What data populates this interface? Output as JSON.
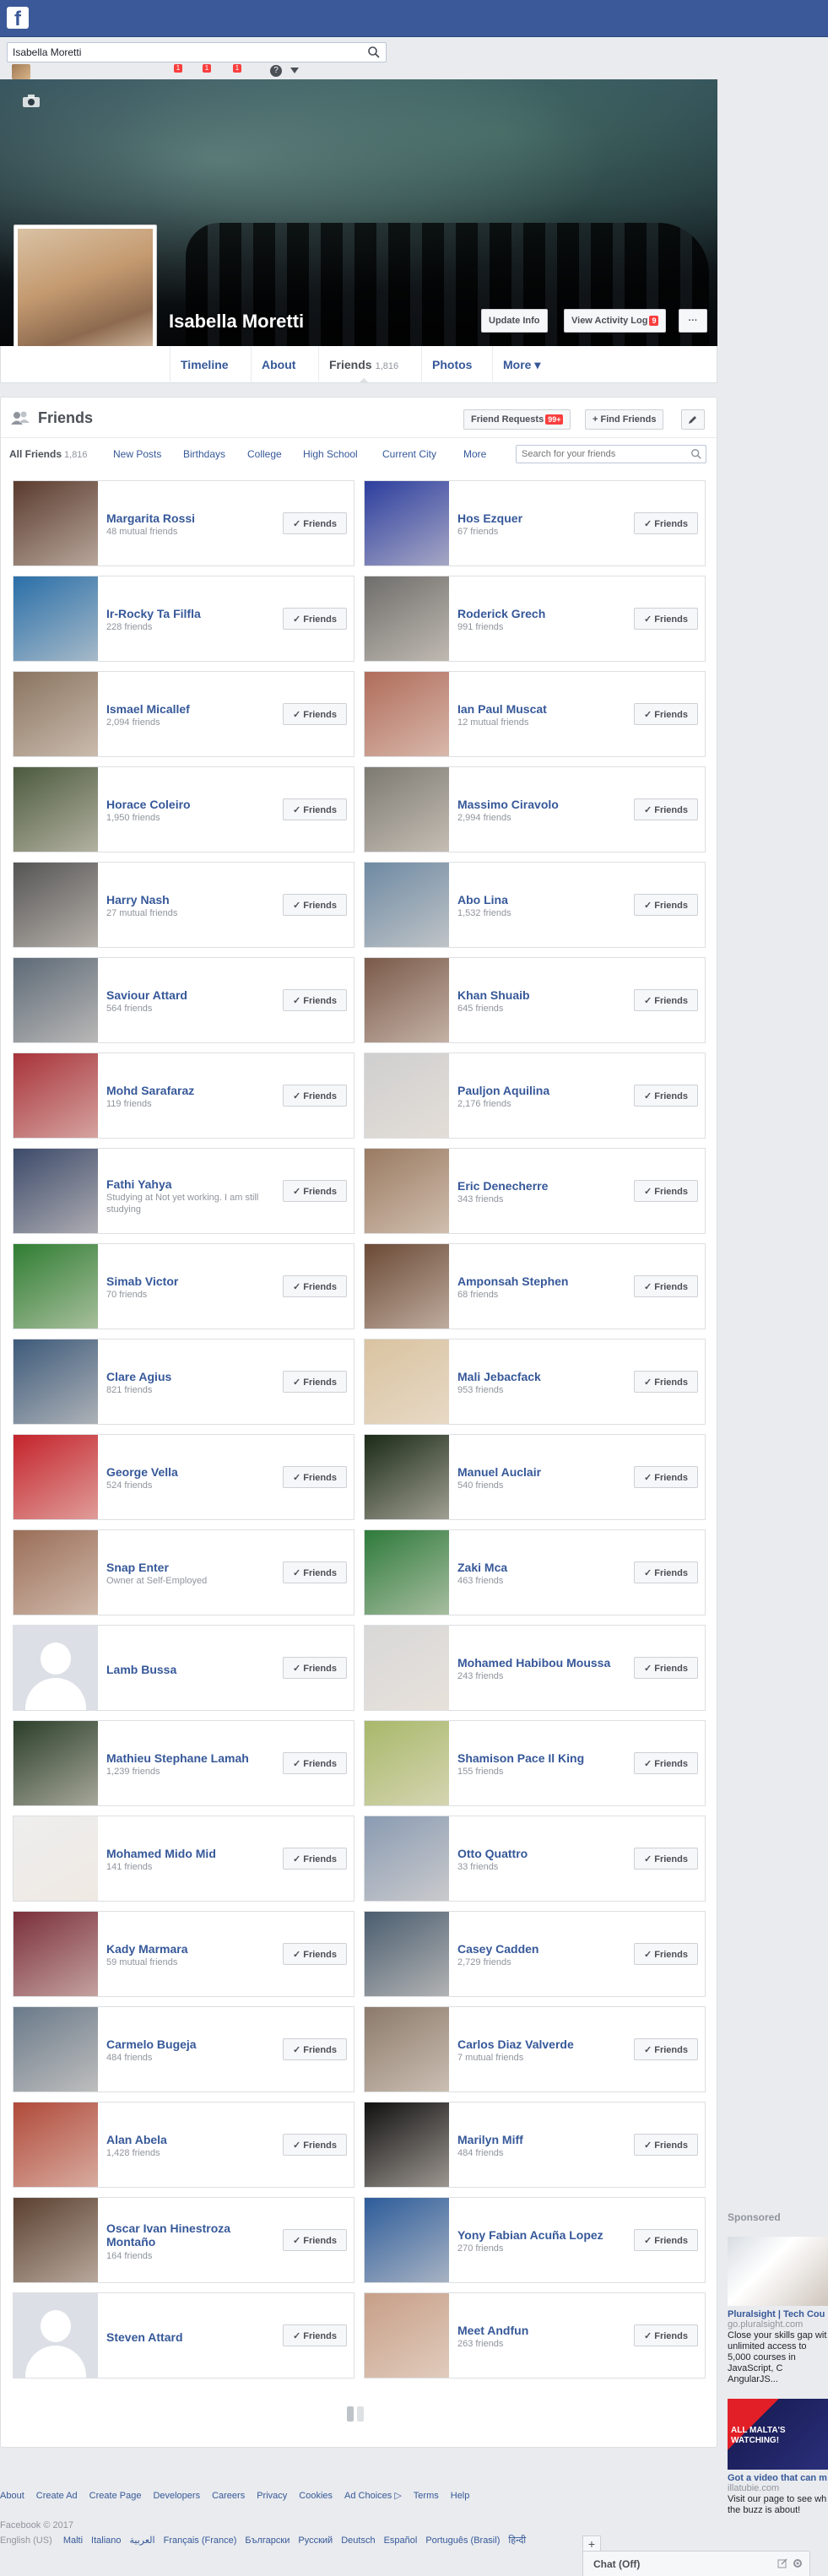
{
  "search": {
    "value": "Isabella Moretti"
  },
  "header": {
    "notifications": [
      "1",
      "1",
      "1"
    ]
  },
  "profile": {
    "name": "Isabella Moretti",
    "update_info": "Update Info",
    "view_activity_log": "View Activity Log",
    "activity_badge": "9",
    "more_dots": "···"
  },
  "timeline_tabs": [
    {
      "label": "Timeline"
    },
    {
      "label": "About"
    },
    {
      "label": "Friends",
      "count": "1,816"
    },
    {
      "label": "Photos"
    },
    {
      "label": "More ▾"
    }
  ],
  "friends_panel": {
    "title": "Friends",
    "friend_requests": "Friend Requests",
    "friend_requests_badge": "99+",
    "find_friends": "+ Find Friends",
    "search_placeholder": "Search for your friends",
    "tabs": [
      {
        "label": "All Friends",
        "count": "1,816"
      },
      {
        "label": "New Posts"
      },
      {
        "label": "Birthdays"
      },
      {
        "label": "College"
      },
      {
        "label": "High School"
      },
      {
        "label": "Current City"
      },
      {
        "label": "More"
      }
    ],
    "button_label": "Friends",
    "friends": [
      {
        "name": "Margarita Rossi",
        "sub": "48 mutual friends",
        "photo": "#5a3b2e"
      },
      {
        "name": "Hos Ezquer",
        "sub": "67 friends",
        "photo": "#2c3e9e"
      },
      {
        "name": "Ir-Rocky Ta Filfla",
        "sub": "228 friends",
        "photo": "#2a6fa8"
      },
      {
        "name": "Roderick Grech",
        "sub": "991 friends",
        "photo": "#6f6e6b"
      },
      {
        "name": "Ismael Micallef",
        "sub": "2,094 friends",
        "photo": "#8a7460"
      },
      {
        "name": "Ian Paul Muscat",
        "sub": "12 mutual friends",
        "photo": "#b06c5a"
      },
      {
        "name": "Horace Coleiro",
        "sub": "1,950 friends",
        "photo": "#4c5a3e"
      },
      {
        "name": "Massimo Ciravolo",
        "sub": "2,994 friends",
        "photo": "#7d7a72"
      },
      {
        "name": "Harry Nash",
        "sub": "27 mutual friends",
        "photo": "#555555"
      },
      {
        "name": "Abo Lina",
        "sub": "1,532 friends",
        "photo": "#6e8aa3"
      },
      {
        "name": "Saviour Attard",
        "sub": "564 friends",
        "photo": "#5d6a77"
      },
      {
        "name": "Khan Shuaib",
        "sub": "645 friends",
        "photo": "#7a5a4a"
      },
      {
        "name": "Mohd Sarafaraz",
        "sub": "119 friends",
        "photo": "#a8333a"
      },
      {
        "name": "Pauljon Aquilina",
        "sub": "2,176 friends",
        "photo": "#cfcfcf"
      },
      {
        "name": "Fathi Yahya",
        "sub": "Studying at Not yet working. I am still studying",
        "photo": "#3c4a6a"
      },
      {
        "name": "Eric Denecherre",
        "sub": "343 friends",
        "photo": "#9a7b62"
      },
      {
        "name": "Simab Victor",
        "sub": "70 friends",
        "photo": "#2f7d32"
      },
      {
        "name": "Amponsah Stephen",
        "sub": "68 friends",
        "photo": "#6b4a36"
      },
      {
        "name": "Clare Agius",
        "sub": "821 friends",
        "photo": "#3d5a7a"
      },
      {
        "name": "Mali Jebacfack",
        "sub": "953 friends",
        "photo": "#d9c3a0"
      },
      {
        "name": "George Vella",
        "sub": "524 friends",
        "photo": "#c4232b"
      },
      {
        "name": "Manuel Auclair",
        "sub": "540 friends",
        "photo": "#1b2a17"
      },
      {
        "name": "Snap Enter",
        "sub": "Owner at Self-Employed",
        "photo": "#9a6e58"
      },
      {
        "name": "Zaki Mca",
        "sub": "463 friends",
        "photo": "#2e7a3b"
      },
      {
        "name": "Lamb Bussa",
        "sub": "",
        "photo": "silhouette"
      },
      {
        "name": "Mohamed Habibou Moussa",
        "sub": "243 friends",
        "photo": "#d8d8d8"
      },
      {
        "name": "Mathieu Stephane Lamah",
        "sub": "1,239 friends",
        "photo": "#2b3e2a"
      },
      {
        "name": "Shamison Pace Il King",
        "sub": "155 friends",
        "photo": "#a8b86a"
      },
      {
        "name": "Mohamed Mido Mid",
        "sub": "141 friends",
        "photo": "#eeeeee"
      },
      {
        "name": "Otto Quattro",
        "sub": "33 friends",
        "photo": "#8a9bb2"
      },
      {
        "name": "Kady Marmara",
        "sub": "59 mutual friends",
        "photo": "#7a2f3a"
      },
      {
        "name": "Casey Cadden",
        "sub": "2,729 friends",
        "photo": "#4a5d6f"
      },
      {
        "name": "Carmelo Bugeja",
        "sub": "484 friends",
        "photo": "#6a7a8a"
      },
      {
        "name": "Carlos Diaz Valverde",
        "sub": "7 mutual friends",
        "photo": "#8c7b6c"
      },
      {
        "name": "Alan Abela",
        "sub": "1,428 friends",
        "photo": "#b04a3a"
      },
      {
        "name": "Marilyn Miff",
        "sub": "484 friends",
        "photo": "#111111"
      },
      {
        "name": "Oscar Ivan Hinestroza Montaño",
        "sub": "164 friends",
        "photo": "#5a4030"
      },
      {
        "name": "Yony Fabian Acuña Lopez",
        "sub": "270 friends",
        "photo": "#2d5c9a"
      },
      {
        "name": "Steven Attard",
        "sub": "",
        "photo": "silhouette"
      },
      {
        "name": "Meet Andfun",
        "sub": "263 friends",
        "photo": "#c79f88"
      }
    ]
  },
  "footer": {
    "links": [
      "About",
      "Create Ad",
      "Create Page",
      "Developers",
      "Careers",
      "Privacy",
      "Cookies",
      "Ad Choices ▷",
      "Terms",
      "Help"
    ],
    "copyright": "Facebook © 2017",
    "current_language": "English (US)",
    "languages": [
      "Malti",
      "Italiano",
      "العربية",
      "Français (France)",
      "Български",
      "Русский",
      "Deutsch",
      "Español",
      "Português (Brasil)",
      "हिन्दी"
    ]
  },
  "sponsored": {
    "title": "Sponsored",
    "ad1": {
      "headline": "Pluralsight | Tech Cou",
      "domain": "go.pluralsight.com",
      "desc": "Close your skills gap wit unlimited access to 5,000 courses in JavaScript, C AngularJS..."
    },
    "ad2": {
      "image_text": "ALL MALTA'S WATCHING!",
      "headline": "Got a video that can m",
      "domain": "illatubie.com",
      "desc": "Visit our page to see wh the buzz is about!"
    }
  },
  "chat": {
    "label": "Chat (Off)"
  }
}
